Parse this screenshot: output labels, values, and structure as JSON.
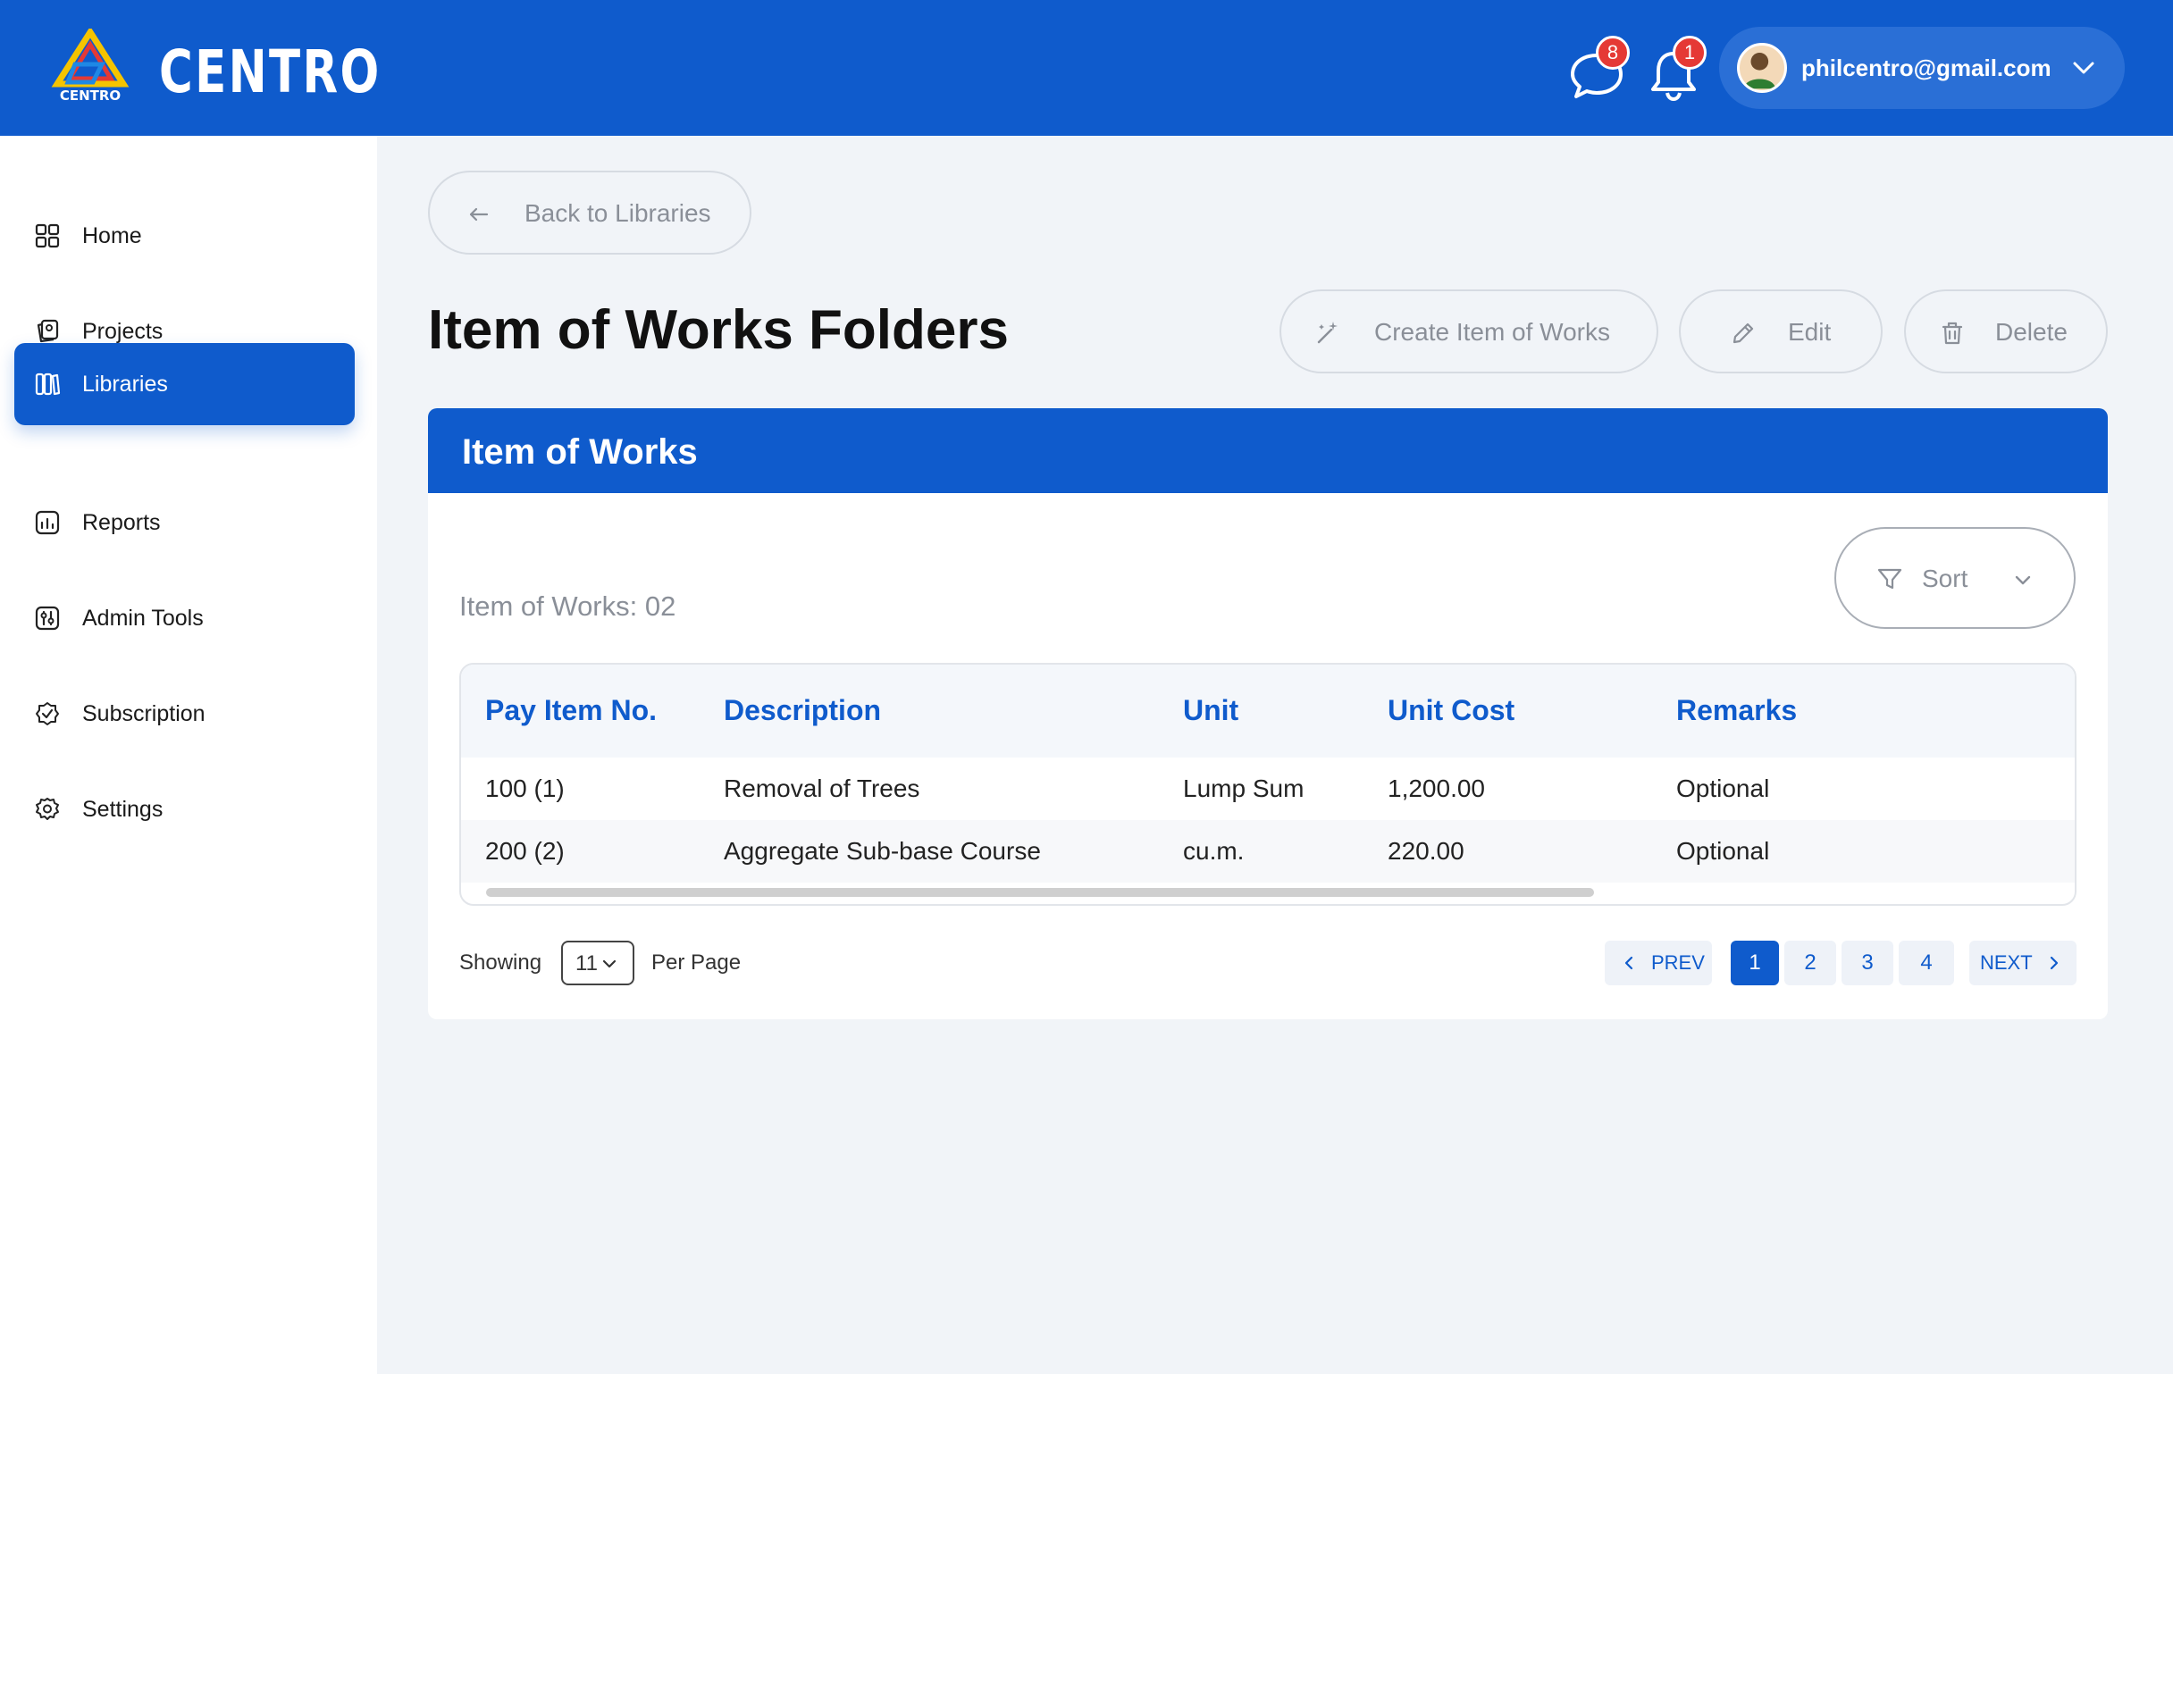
{
  "app": {
    "brand": "CENTRO",
    "logo_text": "CENTRO"
  },
  "header": {
    "messages_badge": "8",
    "notifications_badge": "1",
    "user_email": "philcentro@gmail.com"
  },
  "sidebar": {
    "items": [
      {
        "label": "Home",
        "icon": "grid-icon",
        "active": false
      },
      {
        "label": "Projects",
        "icon": "projects-icon",
        "active": false
      },
      {
        "label": "Libraries",
        "icon": "books-icon",
        "active": true
      },
      {
        "label": "Reports",
        "icon": "reports-icon",
        "active": false
      },
      {
        "label": "Admin Tools",
        "icon": "admin-tools-icon",
        "active": false
      },
      {
        "label": "Subscription",
        "icon": "badge-check-icon",
        "active": false
      },
      {
        "label": "Settings",
        "icon": "settings-icon",
        "active": false
      }
    ]
  },
  "main": {
    "back_label": "Back to Libraries",
    "page_title": "Item of Works Folders",
    "actions": {
      "create_label": "Create Item of Works",
      "edit_label": "Edit",
      "delete_label": "Delete"
    },
    "card": {
      "title": "Item of Works",
      "count_label": "Item of Works: 02",
      "sort_label": "Sort",
      "table": {
        "columns": [
          "Pay Item No.",
          "Description",
          "Unit",
          "Unit Cost",
          "Remarks"
        ],
        "rows": [
          [
            "100 (1)",
            "Removal of Trees",
            "Lump Sum",
            "1,200.00",
            "Optional"
          ],
          [
            "200 (2)",
            "Aggregate Sub-base Course",
            "cu.m.",
            "220.00",
            "Optional"
          ]
        ]
      },
      "pagination": {
        "showing_label": "Showing",
        "per_page_value": "11",
        "per_page_label": "Per Page",
        "prev_label": "PREV",
        "next_label": "NEXT",
        "pages": [
          "1",
          "2",
          "3",
          "4"
        ],
        "current_page": "1"
      }
    }
  },
  "colors": {
    "primary": "#0f5bcc",
    "background": "#f1f4f8",
    "badge": "#e53935",
    "muted_text": "#8a8f98"
  }
}
